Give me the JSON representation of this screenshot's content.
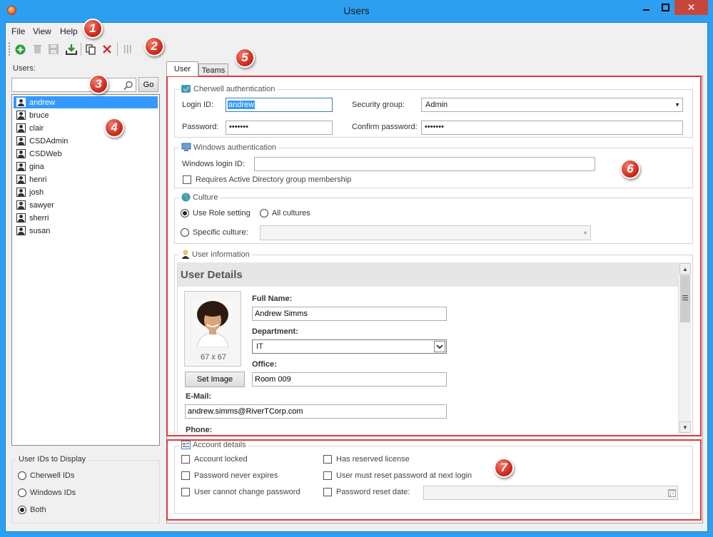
{
  "window": {
    "title": "Users"
  },
  "menu": [
    "File",
    "View",
    "Help"
  ],
  "toolbar": {
    "icons": [
      "add-icon",
      "delete-icon",
      "save-icon",
      "download-icon",
      "copy-icon",
      "close-icon",
      "columns-icon"
    ]
  },
  "callouts": [
    "1",
    "2",
    "3",
    "4",
    "5",
    "6",
    "7"
  ],
  "left_panel": {
    "users_label": "Users:",
    "search_value": "",
    "go_label": "Go",
    "users": [
      "andrew",
      "bruce",
      "clair",
      "CSDAdmin",
      "CSDWeb",
      "gina",
      "henri",
      "josh",
      "sawyer",
      "sherri",
      "susan"
    ],
    "selected_user": "andrew",
    "id_group_title": "User IDs to Display",
    "id_options": [
      "Cherwell IDs",
      "Windows IDs",
      "Both"
    ],
    "id_selected": "Both"
  },
  "tabs": [
    "User",
    "Teams"
  ],
  "cherwell_auth": {
    "title": "Cherwell authentication",
    "login_label": "Login ID:",
    "login_value": "andrew",
    "security_label": "Security group:",
    "security_value": "Admin",
    "password_label": "Password:",
    "password_value": "•••••••",
    "confirm_label": "Confirm password:",
    "confirm_value": "•••••••"
  },
  "windows_auth": {
    "title": "Windows authentication",
    "login_label": "Windows login ID:",
    "login_value": "",
    "requires_ad": "Requires Active Directory group membership"
  },
  "culture": {
    "title": "Culture",
    "use_role": "Use Role setting",
    "all_cultures": "All cultures",
    "specific": "Specific culture:",
    "specific_value": ""
  },
  "user_info": {
    "title": "User information",
    "header": "User Details",
    "full_name_label": "Full Name:",
    "full_name_value": "Andrew Simms",
    "department_label": "Department:",
    "department_value": "IT",
    "office_label": "Office:",
    "office_value": "Room 009",
    "photo_size": "67 x 67",
    "set_image_label": "Set Image",
    "email_label": "E-Mail:",
    "email_value": "andrew.simms@RiverTCorp.com",
    "phone_label": "Phone:"
  },
  "account": {
    "title": "Account details",
    "account_locked": "Account locked",
    "has_reserved": "Has reserved license",
    "never_expires": "Password never expires",
    "must_reset": "User must reset password at next login",
    "cannot_change": "User cannot change password",
    "reset_date_label": "Password reset date:",
    "reset_date_value": ""
  },
  "colors": {
    "title_bar": "#2d9ff0",
    "selection": "#3399ff",
    "callout": "#c92416",
    "highlight_box": "#e0393b",
    "close_button": "#c7463a"
  }
}
